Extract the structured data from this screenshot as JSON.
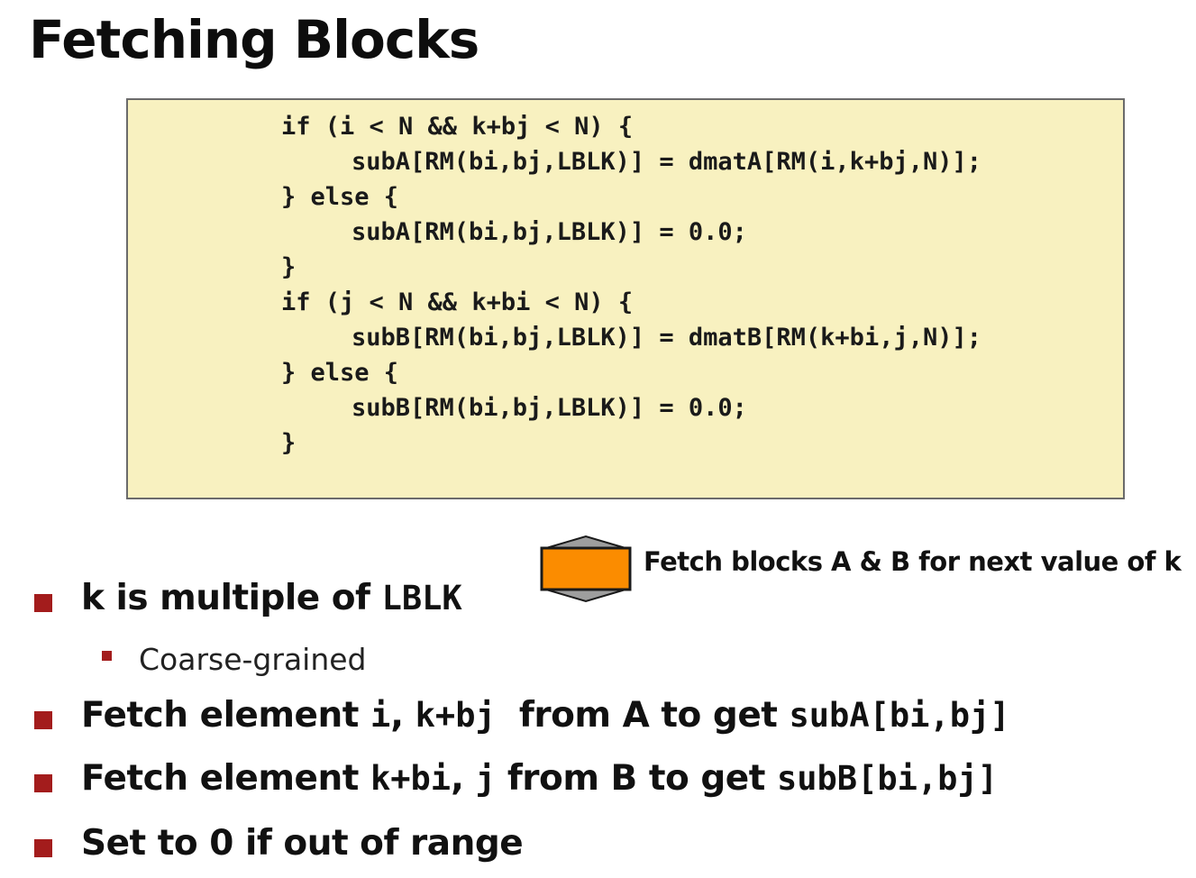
{
  "slide": {
    "title": "Fetching Blocks"
  },
  "code": {
    "lines": [
      {
        "indent": 0,
        "text": "if (i < N && k+bj < N) {"
      },
      {
        "indent": 1,
        "text": "subA[RM(bi,bj,LBLK)] = dmatA[RM(i,k+bj,N)];"
      },
      {
        "indent": 0,
        "text": "} else {"
      },
      {
        "indent": 1,
        "text": "subA[RM(bi,bj,LBLK)] = 0.0;"
      },
      {
        "indent": 0,
        "text": "}"
      },
      {
        "indent": 0,
        "text": "if (j < N && k+bi < N) {"
      },
      {
        "indent": 1,
        "text": "subB[RM(bi,bj,LBLK)] = dmatB[RM(k+bi,j,N)];"
      },
      {
        "indent": 0,
        "text": "} else {"
      },
      {
        "indent": 1,
        "text": "subB[RM(bi,bj,LBLK)] = 0.0;"
      },
      {
        "indent": 0,
        "text": "}"
      }
    ]
  },
  "callout": {
    "text": "Fetch blocks A & B for next value of k",
    "shape_fill": "#fb8c00",
    "shape_outline": "#1a1a1a",
    "shape_cap": "#9e9e9e"
  },
  "bullets": {
    "b1": {
      "pre": "k is multiple of ",
      "code": "LBLK"
    },
    "b1_sub": {
      "text": "Coarse-grained"
    },
    "b2": {
      "pre": "Fetch element ",
      "code1": "i",
      "mid1": ", ",
      "code2": "k+bj",
      "mid2": "  from A to get ",
      "code3": "subA[bi,bj]"
    },
    "b3": {
      "pre": "Fetch element ",
      "code1": "k+bi",
      "mid1": ", ",
      "code2": "j",
      "mid2": " from B to get ",
      "code3": "subB[bi,bj]"
    },
    "b4": {
      "text": "Set to 0 if out of range"
    }
  },
  "colors": {
    "bullet": "#a31c1c",
    "code_background": "#f8f1c0"
  }
}
